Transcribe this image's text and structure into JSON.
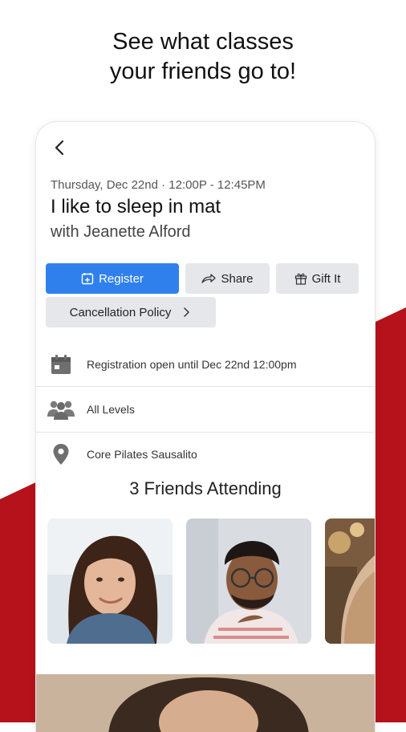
{
  "headline": [
    "See what classes",
    "your friends go to!"
  ],
  "colors": {
    "brand_red": "#b5121b",
    "register_blue": "#2f80ed",
    "button_gray": "#e5e7ea"
  },
  "class": {
    "date_time": "Thursday, Dec 22nd · 12:00P - 12:45PM",
    "title": "I like to sleep in mat",
    "instructor": "with Jeanette Alford"
  },
  "actions": {
    "register": "Register",
    "share": "Share",
    "gift": "Gift It",
    "cancellation": "Cancellation Policy"
  },
  "info": {
    "registration": "Registration open until Dec 22nd 12:00pm",
    "level": "All Levels",
    "location": "Core Pilates Sausalito"
  },
  "friends": {
    "title": "3 Friends Attending"
  },
  "icons": [
    "back-arrow-icon",
    "calendar-plus-icon",
    "share-arrow-icon",
    "gift-icon",
    "chevron-right-icon",
    "calendar-icon",
    "people-icon",
    "location-pin-icon"
  ]
}
